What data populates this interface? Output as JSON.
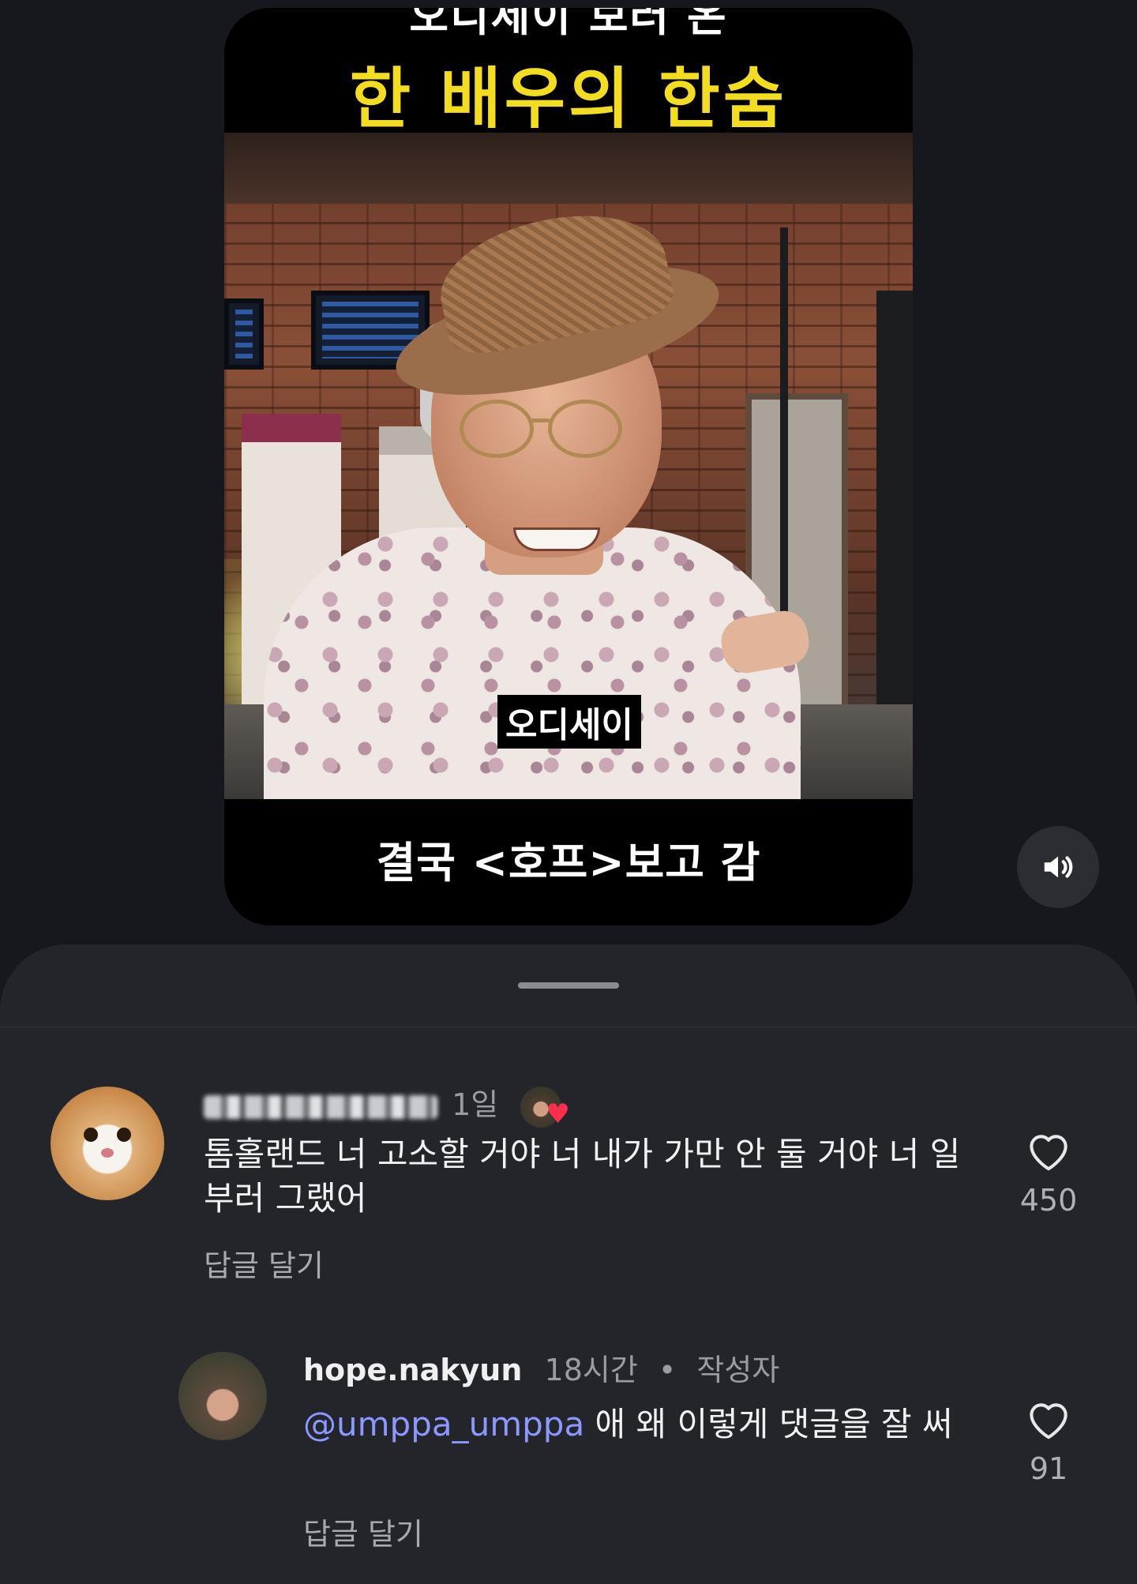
{
  "video": {
    "top_text_cut": "오디세이 보러 온",
    "headline": "한 배우의 한숨",
    "subtitle_chip": "오디세이",
    "caption": "결국 <호프>보고 감"
  },
  "controls": {
    "mute_icon": "speaker-volume-icon"
  },
  "comments": [
    {
      "username_hidden": "umppa_umppa",
      "time": "1일",
      "creator_liked_icon": "heart-icon",
      "text": "톰홀랜드 너 고소할 거야 너 내가 가만 안 둘 거야 너 일부러 그랬어",
      "reply_label": "답글 달기",
      "likes": "450"
    },
    {
      "username": "hope.nakyun",
      "time": "18시간",
      "separator": "•",
      "author_badge": "작성자",
      "mention": "@umppa_umppa",
      "text": " 애 왜 이렇게 댓글을 잘 써",
      "reply_label": "답글 달기",
      "likes": "91"
    }
  ],
  "colors": {
    "background": "#16181e",
    "sheet": "#23252b",
    "headline_yellow": "#f2dd1f",
    "mention_blue": "#8c97ff",
    "heart_red": "#ff2e4d"
  }
}
